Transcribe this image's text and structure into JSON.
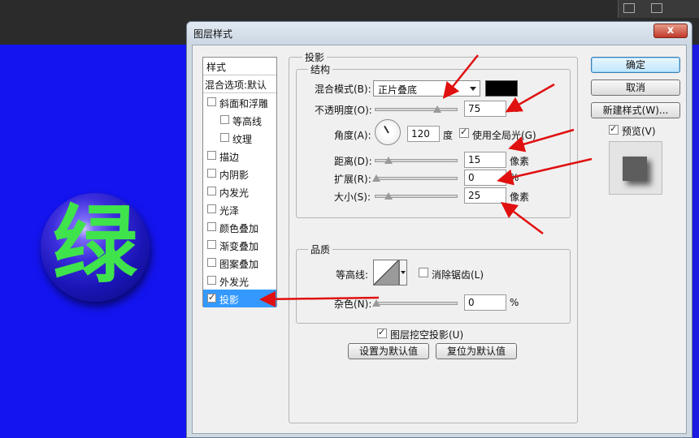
{
  "dialog": {
    "title": "图层样式",
    "close_label": "x"
  },
  "canvas": {
    "glyph": "绿",
    "glyph_color": "#3fe34c",
    "background_color": "#1414f0"
  },
  "style_list": {
    "header": "样式",
    "blend_options": "混合选项:默认",
    "items": [
      {
        "label": "斜面和浮雕",
        "checked": false,
        "sub": false,
        "selected": false
      },
      {
        "label": "等高线",
        "checked": false,
        "sub": true,
        "selected": false
      },
      {
        "label": "纹理",
        "checked": false,
        "sub": true,
        "selected": false
      },
      {
        "label": "描边",
        "checked": false,
        "sub": false,
        "selected": false
      },
      {
        "label": "内阴影",
        "checked": false,
        "sub": false,
        "selected": false
      },
      {
        "label": "内发光",
        "checked": false,
        "sub": false,
        "selected": false
      },
      {
        "label": "光泽",
        "checked": false,
        "sub": false,
        "selected": false
      },
      {
        "label": "颜色叠加",
        "checked": false,
        "sub": false,
        "selected": false
      },
      {
        "label": "渐变叠加",
        "checked": false,
        "sub": false,
        "selected": false
      },
      {
        "label": "图案叠加",
        "checked": false,
        "sub": false,
        "selected": false
      },
      {
        "label": "外发光",
        "checked": false,
        "sub": false,
        "selected": false
      },
      {
        "label": "投影",
        "checked": true,
        "sub": false,
        "selected": true
      }
    ]
  },
  "drop_shadow": {
    "section_title": "投影",
    "structure": {
      "title": "结构",
      "blend_mode_label": "混合模式(B):",
      "blend_mode_value": "正片叠底",
      "shadow_color": "#000000",
      "opacity_label": "不透明度(O):",
      "opacity_value": "75",
      "opacity_unit": "%",
      "opacity_level": 0.75,
      "angle_label": "角度(A):",
      "angle_value": "120",
      "angle_unit": "度",
      "use_global_light_label": "使用全局光(G)",
      "use_global_light_checked": true,
      "distance_label": "距离(D):",
      "distance_value": "15",
      "distance_unit": "像素",
      "spread_label": "扩展(R):",
      "spread_value": "0",
      "spread_unit": "%",
      "size_label": "大小(S):",
      "size_value": "25",
      "size_unit": "像素"
    },
    "quality": {
      "title": "品质",
      "contour_label": "等高线:",
      "anti_alias_label": "消除锯齿(L)",
      "anti_alias_checked": false,
      "noise_label": "杂色(N):",
      "noise_value": "0",
      "noise_unit": "%"
    },
    "knockout_label": "图层挖空投影(U)",
    "knockout_checked": true,
    "make_default_label": "设置为默认值",
    "reset_default_label": "复位为默认值"
  },
  "buttons": {
    "ok": "确定",
    "cancel": "取消",
    "new_style": "新建样式(W)...",
    "preview_label": "预览(V)",
    "preview_checked": true
  },
  "annotation_color": "#e01010"
}
